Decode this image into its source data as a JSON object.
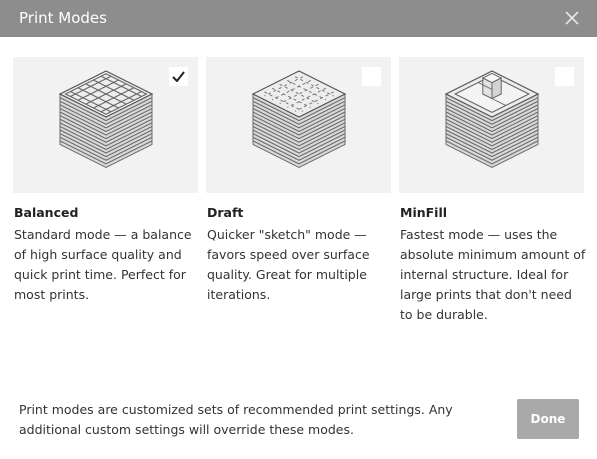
{
  "dialog": {
    "title": "Print Modes",
    "close_icon": "close-icon"
  },
  "modes": [
    {
      "name": "Balanced",
      "description": "Standard mode — a balance of high surface quality and quick print time. Perfect for most prints.",
      "selected": true,
      "illustration": "layered-cube-grid-infill"
    },
    {
      "name": "Draft",
      "description": "Quicker \"sketch\" mode — favors speed over surface quality. Great for multiple iterations.",
      "selected": false,
      "illustration": "layered-cube-dashed-infill"
    },
    {
      "name": "MinFill",
      "description": "Fastest mode — uses the absolute minimum amount of internal structure. Ideal for large prints that don't need to be durable.",
      "selected": false,
      "illustration": "layered-cube-minimal-infill"
    }
  ],
  "footer": {
    "note": "Print modes are customized sets of recommended print settings. Any additional custom settings will override these modes.",
    "done_label": "Done"
  },
  "colors": {
    "titlebar": "#8d8d8d",
    "card_bg": "#f2f2f2",
    "done_bg": "#a9a9a9"
  }
}
